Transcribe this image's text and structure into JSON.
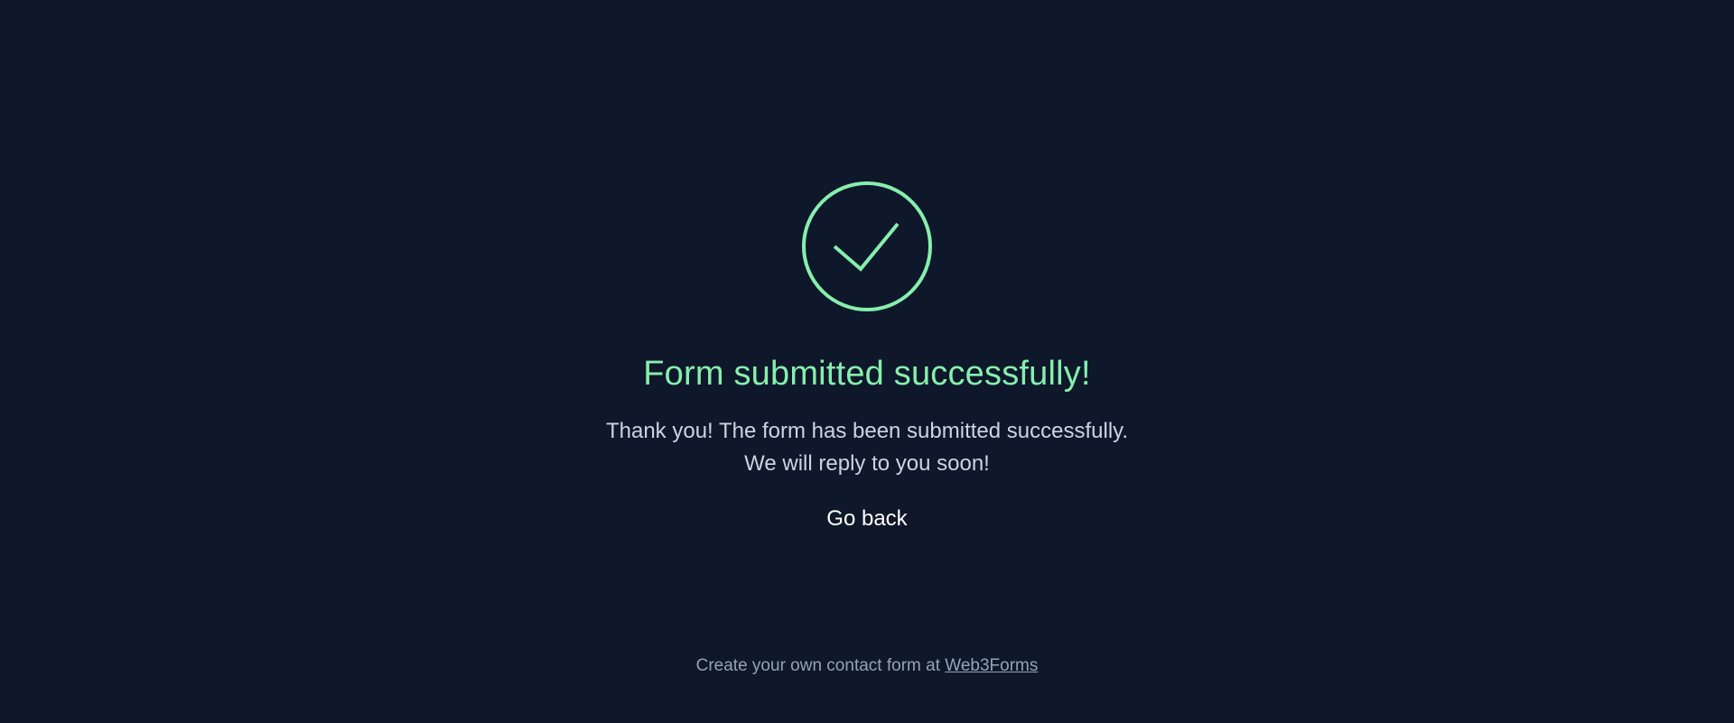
{
  "colors": {
    "background": "#0f172a",
    "accent": "#86efac",
    "message_text": "#cbd5e1",
    "button_text": "#ffffff",
    "footer_text": "#94a3b8"
  },
  "status": {
    "icon": "check-circle-icon",
    "title": "Form submitted successfully!"
  },
  "message": {
    "line1": "Thank you! The form has been submitted successfully.",
    "line2": "We will reply to you soon!"
  },
  "actions": {
    "go_back_label": "Go back"
  },
  "footer": {
    "text": "Create your own contact form at",
    "link_label": "Web3Forms"
  }
}
